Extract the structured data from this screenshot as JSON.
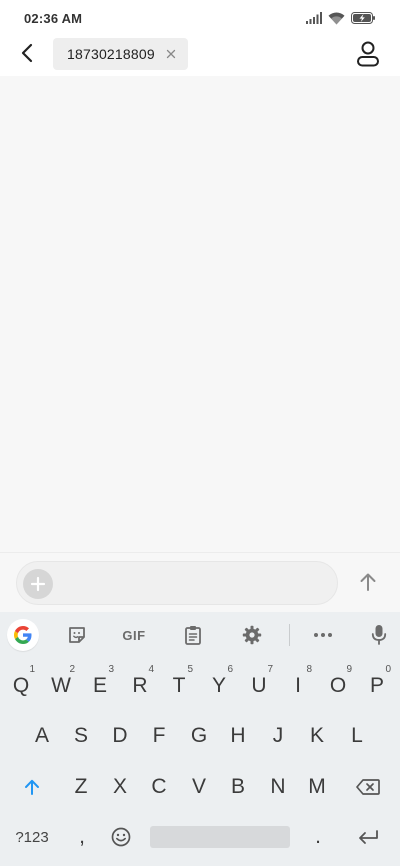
{
  "status_bar": {
    "time": "02:36 AM",
    "icons": [
      "signal-icon",
      "wifi-icon",
      "battery-charging-icon"
    ]
  },
  "header": {
    "recipient": "18730218809",
    "icons": [
      "back-arrow-icon",
      "close-icon",
      "contact-icon"
    ]
  },
  "compose": {
    "placeholder": "",
    "icons": [
      "plus-icon",
      "send-arrow-icon"
    ]
  },
  "keyboard": {
    "toolbar": {
      "gif_label": "GIF",
      "icons": [
        "google-g-icon",
        "sticker-icon",
        "clipboard-icon",
        "settings-icon",
        "more-icon",
        "mic-icon"
      ]
    },
    "row1": [
      {
        "label": "Q",
        "hint": "1"
      },
      {
        "label": "W",
        "hint": "2"
      },
      {
        "label": "E",
        "hint": "3"
      },
      {
        "label": "R",
        "hint": "4"
      },
      {
        "label": "T",
        "hint": "5"
      },
      {
        "label": "Y",
        "hint": "6"
      },
      {
        "label": "U",
        "hint": "7"
      },
      {
        "label": "I",
        "hint": "8"
      },
      {
        "label": "O",
        "hint": "9"
      },
      {
        "label": "P",
        "hint": "0"
      }
    ],
    "row2": [
      "A",
      "S",
      "D",
      "F",
      "G",
      "H",
      "J",
      "K",
      "L"
    ],
    "row3": [
      "Z",
      "X",
      "C",
      "V",
      "B",
      "N",
      "M"
    ],
    "symbols_label": "?123",
    "comma_label": ",",
    "period_label": ".",
    "accent_color": "#2196f3"
  }
}
